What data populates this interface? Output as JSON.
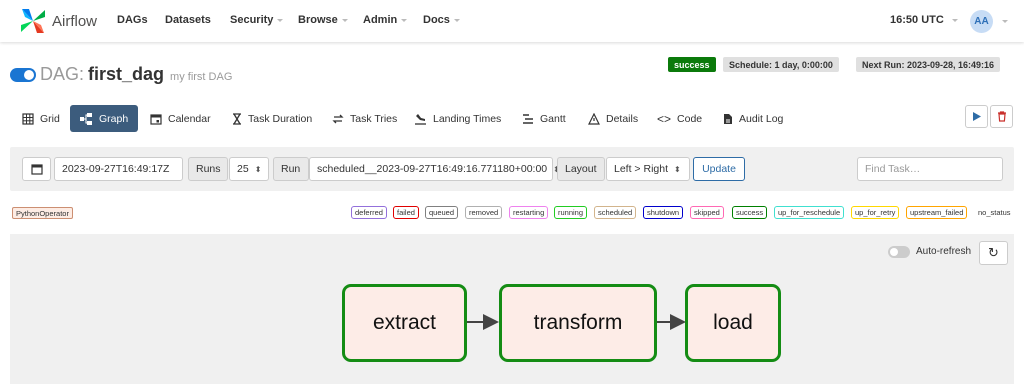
{
  "app": {
    "brand": "Airflow"
  },
  "nav": {
    "dags": "DAGs",
    "datasets": "Datasets",
    "security": "Security",
    "browse": "Browse",
    "admin": "Admin",
    "docs": "Docs",
    "time": "16:50 UTC",
    "user_initials": "AA"
  },
  "dag": {
    "label": "DAG:",
    "id": "first_dag",
    "description": "my first DAG",
    "status": "success",
    "schedule": "Schedule: 1 day, 0:00:00",
    "next_run": "Next Run: 2023-09-28, 16:49:16"
  },
  "tabs": [
    {
      "label": "Grid",
      "icon": "grid-icon"
    },
    {
      "label": "Graph",
      "icon": "graph-icon",
      "active": true
    },
    {
      "label": "Calendar",
      "icon": "calendar-icon"
    },
    {
      "label": "Task Duration",
      "icon": "hourglass-icon"
    },
    {
      "label": "Task Tries",
      "icon": "retry-icon"
    },
    {
      "label": "Landing Times",
      "icon": "landing-icon"
    },
    {
      "label": "Gantt",
      "icon": "gantt-icon"
    },
    {
      "label": "Details",
      "icon": "warning-triangle-icon"
    },
    {
      "label": "Code",
      "icon": "code-icon"
    },
    {
      "label": "Audit Log",
      "icon": "file-icon"
    }
  ],
  "controls": {
    "base_date": "2023-09-27T16:49:17Z",
    "runs_label": "Runs",
    "runs_value": "25",
    "run_label": "Run",
    "run_value": "scheduled__2023-09-27T16:49:16.771180+00:00",
    "layout_label": "Layout",
    "layout_value": "Left > Right",
    "update_label": "Update",
    "find_placeholder": "Find Task…"
  },
  "legend": {
    "operator": "PythonOperator",
    "states": [
      {
        "label": "deferred",
        "color": "#9370db"
      },
      {
        "label": "failed",
        "color": "#e00000"
      },
      {
        "label": "queued",
        "color": "#808080"
      },
      {
        "label": "removed",
        "color": "#b0b0b0"
      },
      {
        "label": "restarting",
        "color": "#ee82ee"
      },
      {
        "label": "running",
        "color": "#22cc22"
      },
      {
        "label": "scheduled",
        "color": "#d2b48c"
      },
      {
        "label": "shutdown",
        "color": "#0000cc"
      },
      {
        "label": "skipped",
        "color": "#ff69b4"
      },
      {
        "label": "success",
        "color": "#008000"
      },
      {
        "label": "up_for_reschedule",
        "color": "#40e0d0"
      },
      {
        "label": "up_for_retry",
        "color": "#ffd700"
      },
      {
        "label": "upstream_failed",
        "color": "#ffa500"
      }
    ],
    "no_status": "no_status"
  },
  "graph": {
    "auto_refresh_label": "Auto-refresh",
    "nodes": [
      "extract",
      "transform",
      "load"
    ],
    "node_border_color": "#148c14"
  }
}
